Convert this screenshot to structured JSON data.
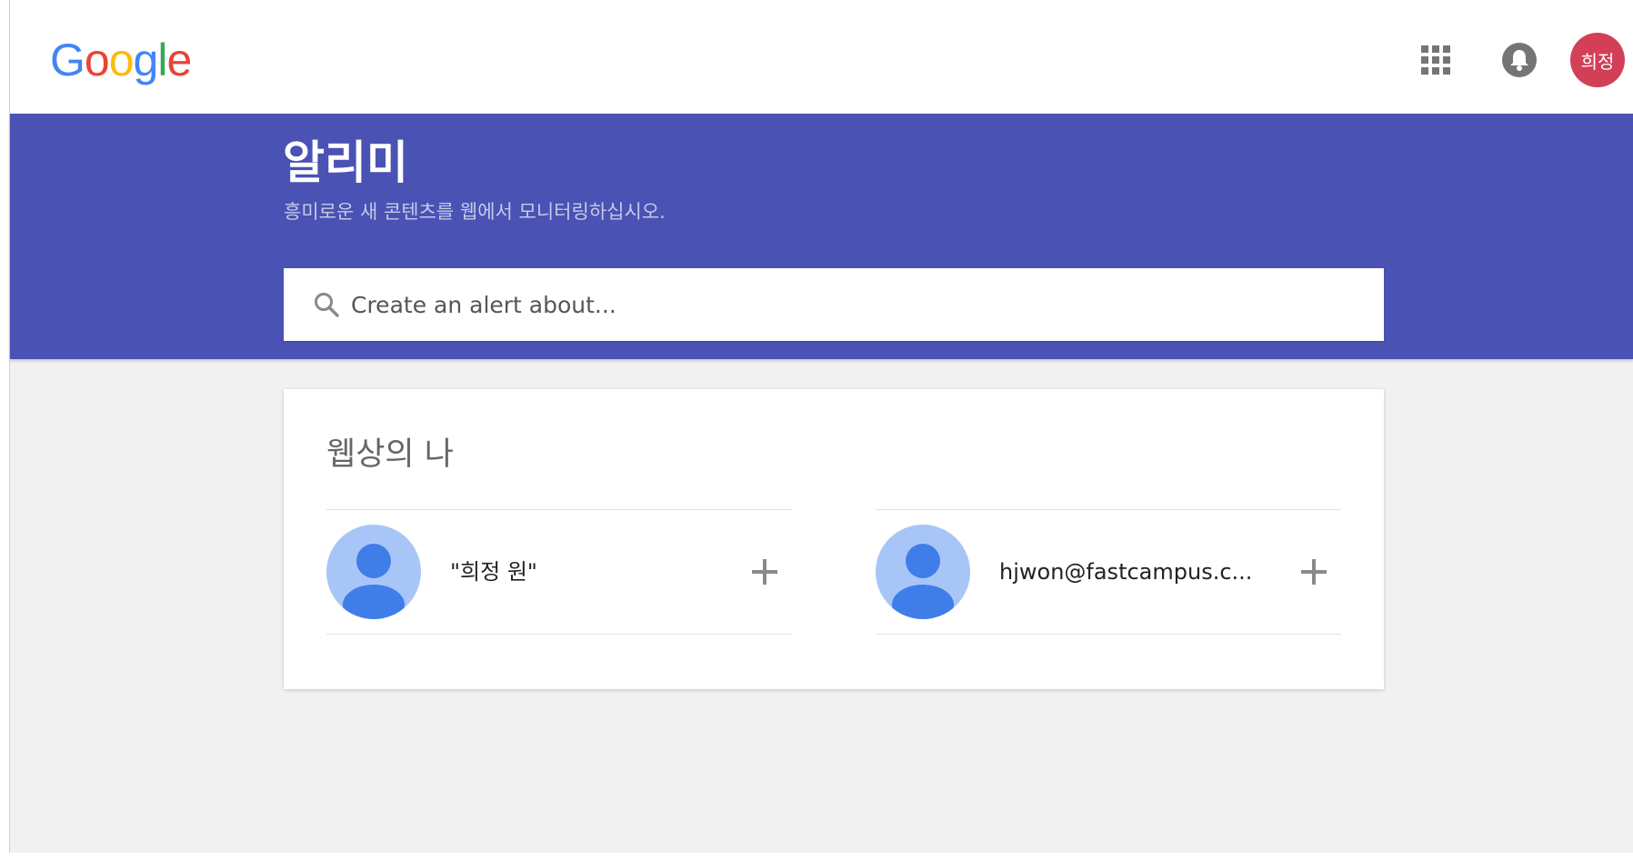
{
  "header": {
    "logo_letters": [
      {
        "char": "G",
        "color": "#4285F4"
      },
      {
        "char": "o",
        "color": "#EA4335"
      },
      {
        "char": "o",
        "color": "#FBBC05"
      },
      {
        "char": "g",
        "color": "#4285F4"
      },
      {
        "char": "l",
        "color": "#34A853"
      },
      {
        "char": "e",
        "color": "#EA4335"
      }
    ],
    "apps_icon": "apps-grid-icon",
    "notifications_icon": "bell-icon",
    "account_initials": "희정",
    "account_color": "#D23F57"
  },
  "banner": {
    "color": "#4A52B4",
    "title": "알리미",
    "subtitle": "흥미로운 새 콘텐츠를 웹에서 모니터링하십시오."
  },
  "search": {
    "placeholder": "Create an alert about...",
    "value": "",
    "icon": "search-icon"
  },
  "card": {
    "title": "웹상의 나",
    "items": [
      {
        "label": "\"희정 원\"",
        "icon": "person-avatar-icon",
        "action_icon": "plus-icon"
      },
      {
        "label": "hjwon@fastcampus.c...",
        "icon": "person-avatar-icon",
        "action_icon": "plus-icon"
      }
    ]
  },
  "colors": {
    "background": "#F1F1F1",
    "avatar_bg": "#A7C6F7",
    "avatar_figure": "#3F7EE8",
    "icon_gray": "#757575"
  }
}
